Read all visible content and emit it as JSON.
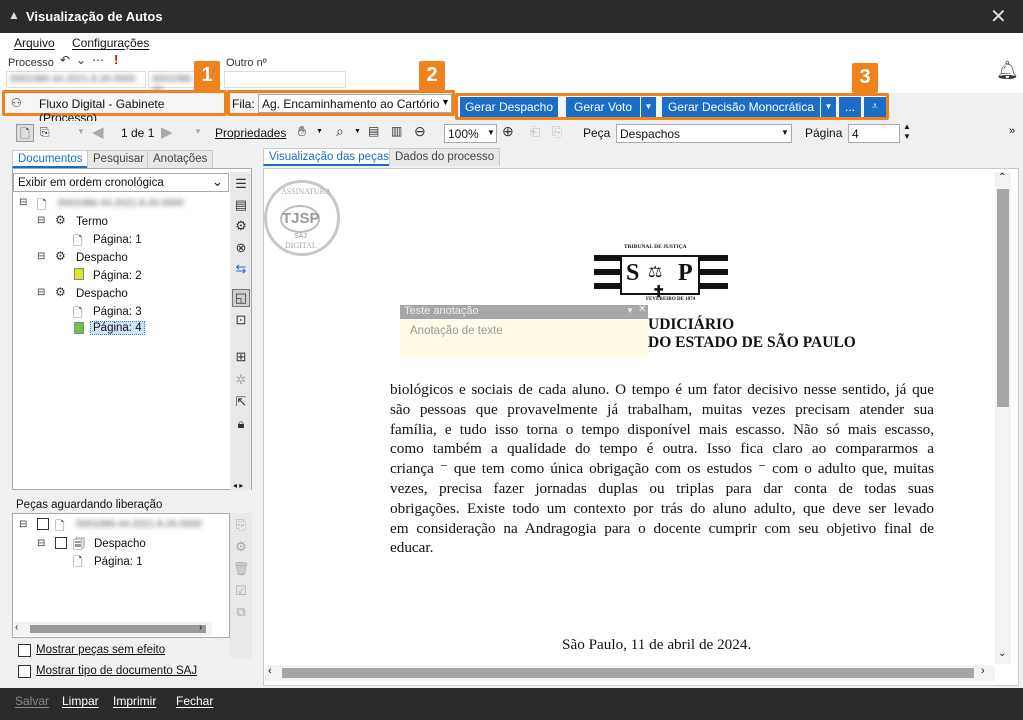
{
  "window": {
    "title": "Visualização de Autos"
  },
  "menu": {
    "file": "Arquivo",
    "settings": "Configurações"
  },
  "header": {
    "processo_label": "Processo",
    "processo_value": "0001086-44.2021.8.26.0000",
    "other_blur": "0001086-44",
    "outro_label": "Outro nº",
    "outro_value": ""
  },
  "badges": [
    "1",
    "2",
    "3"
  ],
  "flow": {
    "label": "Fluxo Digital - Gabinete (Processo)"
  },
  "fila": {
    "label": "Fila:",
    "value": "Ag. Encaminhamento ao Cartório"
  },
  "actions": {
    "despacho": "Gerar Despacho",
    "voto": "Gerar Voto",
    "decisao": "Gerar Decisão Monocrática",
    "more": "..."
  },
  "toolbar": {
    "page_of": "1 de 1",
    "properties": "Propriedades",
    "zoom": "100%",
    "peca_label": "Peça",
    "peca_value": "Despachos",
    "pagina_label": "Página",
    "pagina_value": "4"
  },
  "left_tabs": [
    "Documentos",
    "Pesquisar",
    "Anotações"
  ],
  "order_select": "Exibir em ordem cronológica",
  "tree": {
    "root": "0001086-44.2021.8.26.0000",
    "nodes": [
      {
        "label": "Termo",
        "page": "Página: 1"
      },
      {
        "label": "Despacho",
        "page": "Página: 2"
      },
      {
        "label": "Despacho",
        "page": "Página: 3"
      },
      {
        "label": "",
        "page": "Página: 4"
      }
    ]
  },
  "pending": {
    "title": "Peças aguardando liberação",
    "root": "0001086-44.2021.8.26.0000",
    "item": "Despacho",
    "page": "Página: 1"
  },
  "checkboxes": {
    "no_effect": "Mostrar peças sem efeito",
    "doc_type": "Mostrar tipo de documento SAJ"
  },
  "view_tabs": [
    "Visualização das peças",
    "Dados do processo"
  ],
  "document": {
    "stamp_top": "ASSINATURA",
    "stamp_mid": "TJSP",
    "stamp_saj": "SAJ",
    "stamp_bottom": "DIGITAL",
    "court_top": "TRIBUNAL DE JUSTIÇA",
    "court_date": "FEVEREIRO DE 1874",
    "seal_s": "S",
    "seal_p": "P",
    "heading1": "UDICIÁRIO",
    "heading2": "DO ESTADO DE SÃO PAULO",
    "annotation_title": "Teste anotação",
    "annotation_text": "Anotação de texte",
    "lines": [
      "biológicos e sociais de cada aluno. O tempo é um fator decisivo nesse sentido, já que",
      "são pessoas que provavelmente já trabalham, muitas vezes precisam atender sua",
      "família, e tudo isso torna o tempo disponível mais escasso. Não só mais escasso,",
      "como também a qualidade do tempo é outra. Isso fica claro ao compararmos a",
      "criança ⁻ que tem como única obrigação com os estudos ⁻ com o adulto que, muitas",
      "vezes, precisa fazer jornadas duplas ou triplas para dar conta de todas suas",
      "obrigações. Existe todo um contexto por trás do aluno adulto, que deve ser levado",
      "em consideração na Andragogia para o docente cumprir com seu objetivo final de",
      "educar."
    ],
    "signature_date": "São Paulo, 11 de abril de 2024."
  },
  "bottom": {
    "save": "Salvar",
    "clear": "Limpar",
    "print": "Imprimir",
    "close": "Fechar"
  },
  "colors": {
    "accent": "#1a6ec8",
    "highlight": "#f0821e",
    "titlebar": "#2b2b2b"
  }
}
